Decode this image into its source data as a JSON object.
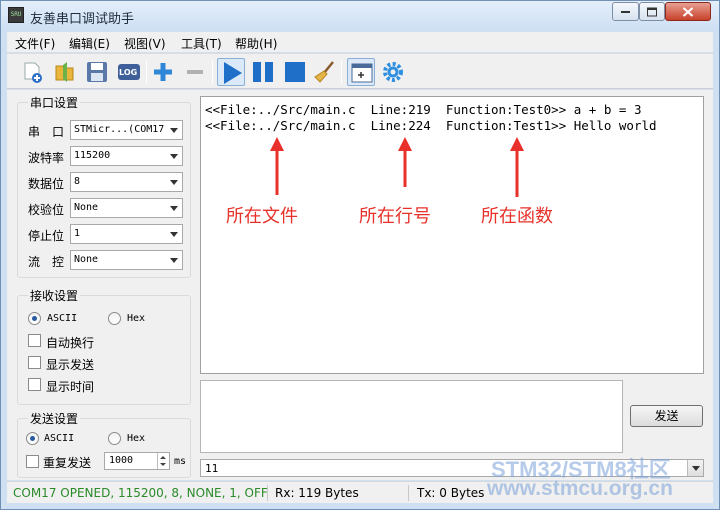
{
  "window": {
    "title": "友善串口调试助手",
    "app_icon_text": "SRU"
  },
  "menu": {
    "items": [
      {
        "label": "文件(F)"
      },
      {
        "label": "编辑(E)"
      },
      {
        "label": "视图(V)"
      },
      {
        "label": "工具(T)"
      },
      {
        "label": "帮助(H)"
      }
    ]
  },
  "toolbar": {
    "log_label": "LOG",
    "icons": [
      "new-file-icon",
      "open-folder-icon",
      "save-icon",
      "log-icon",
      "add-icon",
      "remove-icon",
      "play-icon",
      "pause-icon",
      "stop-icon",
      "broom-icon",
      "window-add-icon",
      "gear-icon"
    ]
  },
  "serial_settings": {
    "title": "串口设置",
    "fields": [
      {
        "label": "串　口",
        "value": "STMicr...(COM17"
      },
      {
        "label": "波特率",
        "value": "115200"
      },
      {
        "label": "数据位",
        "value": "8"
      },
      {
        "label": "校验位",
        "value": "None"
      },
      {
        "label": "停止位",
        "value": "1"
      },
      {
        "label": "流　控",
        "value": "None"
      }
    ]
  },
  "receive_settings": {
    "title": "接收设置",
    "mode_ascii": "ASCII",
    "mode_hex": "Hex",
    "selected_mode": "ASCII",
    "options": [
      {
        "label": "自动换行",
        "checked": false
      },
      {
        "label": "显示发送",
        "checked": false
      },
      {
        "label": "显示时间",
        "checked": false
      }
    ]
  },
  "send_settings": {
    "title": "发送设置",
    "mode_ascii": "ASCII",
    "mode_hex": "Hex",
    "selected_mode": "ASCII",
    "repeat_label": "重复发送",
    "repeat_checked": false,
    "interval_value": "1000",
    "interval_unit": "ms"
  },
  "receive_area": {
    "lines": [
      "<<File:../Src/main.c  Line:219  Function:Test0>> a + b = 3",
      "<<File:../Src/main.c  Line:224  Function:Test1>> Hello world"
    ],
    "annotations": {
      "file": "所在文件",
      "line": "所在行号",
      "function": "所在函数",
      "color": "#e8312a"
    }
  },
  "send_area": {
    "text": "",
    "send_button": "发送",
    "history_value": "11"
  },
  "status_bar": {
    "connection": "COM17 OPENED, 115200, 8, NONE, 1, OFF",
    "rx": "Rx: 119 Bytes",
    "tx": "Tx: 0 Bytes"
  },
  "watermark": {
    "line1": "STM32/STM8社区",
    "line2": "www.stmcu.org.cn"
  }
}
